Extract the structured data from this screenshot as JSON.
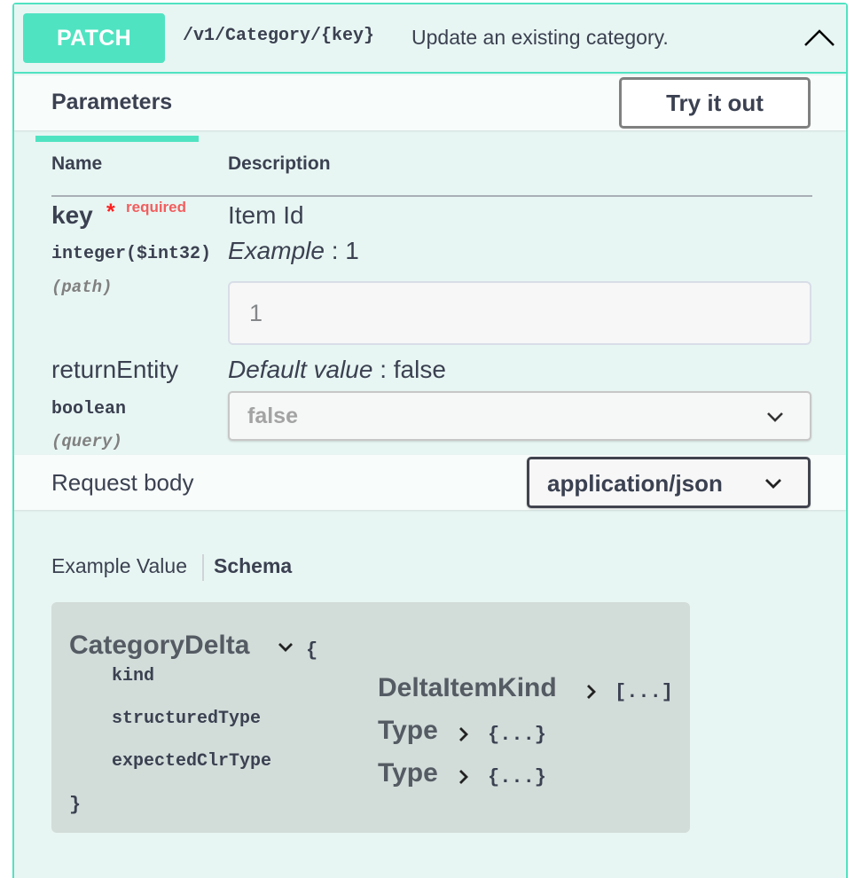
{
  "operation": {
    "method": "PATCH",
    "path": "/v1/Category/{key}",
    "summary": "Update an existing category.",
    "method_color": "#50e3c2"
  },
  "parameters_section": {
    "tab_label": "Parameters",
    "try_button": "Try it out",
    "columns": {
      "name": "Name",
      "description": "Description"
    },
    "params": [
      {
        "name": "key",
        "required_star": "*",
        "required_label": "required",
        "type": "integer($int32)",
        "in": "(path)",
        "description": "Item Id",
        "example_label": "Example",
        "example_sep": " : ",
        "example_value": "1",
        "input_value": "1"
      },
      {
        "name": "returnEntity",
        "type": "boolean",
        "in": "(query)",
        "default_label": "Default value",
        "default_sep": " : ",
        "default_value": "false",
        "select_value": "false"
      }
    ]
  },
  "request_body": {
    "label": "Request body",
    "content_type": "application/json",
    "tabs": {
      "example": "Example Value",
      "schema": "Schema"
    },
    "model": {
      "name": "CategoryDelta",
      "open_brace": "{",
      "close_brace": "}",
      "properties": [
        {
          "name": "kind",
          "type": "DeltaItemKind",
          "collapsed": "[...]"
        },
        {
          "name": "structuredType",
          "type": "Type",
          "collapsed": "{...}"
        },
        {
          "name": "expectedClrType",
          "type": "Type",
          "collapsed": "{...}"
        }
      ]
    }
  }
}
